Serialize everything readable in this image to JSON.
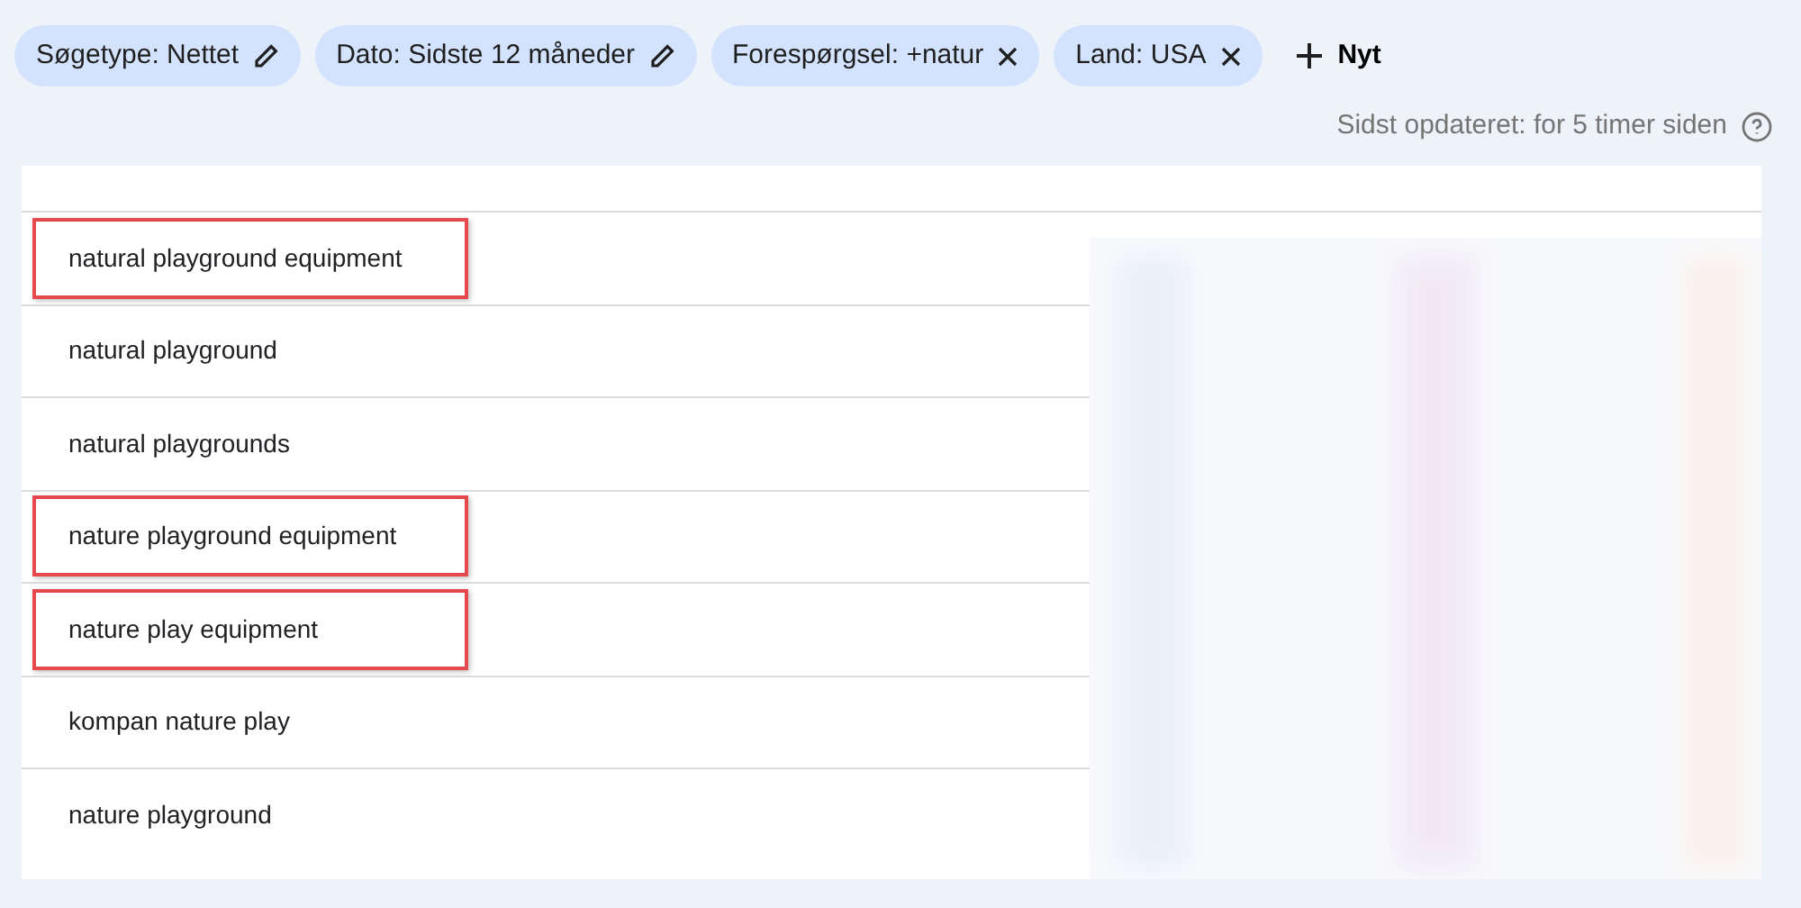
{
  "filters": [
    {
      "label": "Søgetype: Nettet",
      "kind": "edit"
    },
    {
      "label": "Dato: Sidste 12 måneder",
      "kind": "edit"
    },
    {
      "label": "Forespørgsel: +natur",
      "kind": "remove"
    },
    {
      "label": "Land: USA",
      "kind": "remove"
    }
  ],
  "new_filter": {
    "label": "Nyt"
  },
  "last_updated": "Sidst opdateret: for 5 timer siden",
  "queries": [
    {
      "text": "natural playground equipment",
      "highlighted": true
    },
    {
      "text": "natural playground",
      "highlighted": false
    },
    {
      "text": "natural playgrounds",
      "highlighted": false
    },
    {
      "text": "nature playground equipment",
      "highlighted": true
    },
    {
      "text": "nature play equipment",
      "highlighted": true
    },
    {
      "text": "kompan nature play",
      "highlighted": false
    },
    {
      "text": "nature playground",
      "highlighted": false
    }
  ]
}
